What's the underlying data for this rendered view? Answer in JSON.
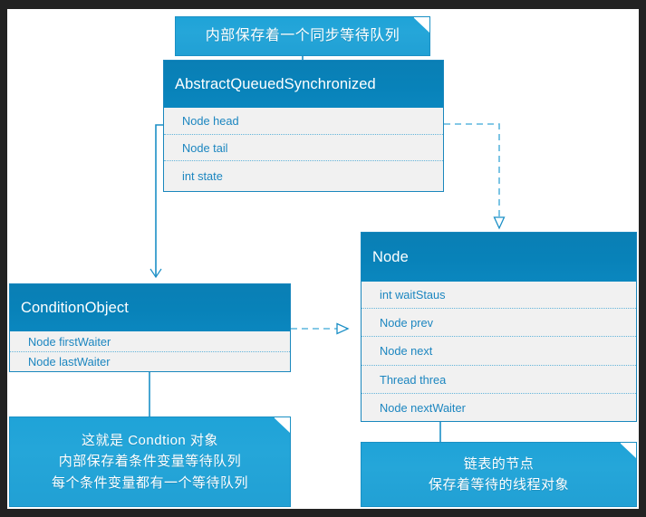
{
  "diagram": {
    "title": "AQS class diagram",
    "colors": {
      "header_blue": "#0882b9",
      "note_blue": "#21a0d4",
      "field_text": "#1c86c0",
      "line_blue": "#1b8fc6",
      "panel_bg": "#f1f1f1",
      "frame": "#222222"
    },
    "classes": [
      {
        "id": "aqs",
        "name": "AbstractQueuedSynchronized",
        "fields": [
          "Node head",
          "Node tail",
          "int state"
        ]
      },
      {
        "id": "condition",
        "name": "ConditionObject",
        "fields": [
          "Node firstWaiter",
          "Node lastWaiter"
        ]
      },
      {
        "id": "node",
        "name": "Node",
        "fields": [
          "int waitStaus",
          "Node prev",
          "Node next",
          "Thread threa",
          "Node nextWaiter"
        ]
      }
    ],
    "notes": [
      {
        "id": "note-top",
        "lines": [
          "内部保存着一个同步等待队列"
        ]
      },
      {
        "id": "note-condition",
        "lines": [
          "这就是 Condtion 对象",
          "内部保存着条件变量等待队列",
          "每个条件变量都有一个等待队列"
        ]
      },
      {
        "id": "note-node",
        "lines": [
          "链表的节点",
          "保存着等待的线程对象"
        ]
      }
    ],
    "connectors": [
      {
        "id": "aqs-to-condition",
        "style": "solid",
        "arrow": "open"
      },
      {
        "id": "aqs-to-node",
        "style": "dashed",
        "arrow": "hollow-triangle"
      },
      {
        "id": "condition-to-node",
        "style": "dashed",
        "arrow": "hollow-triangle"
      },
      {
        "id": "note-top-to-aqs",
        "style": "solid",
        "arrow": "none"
      },
      {
        "id": "condition-to-note",
        "style": "solid",
        "arrow": "none"
      },
      {
        "id": "node-to-note",
        "style": "solid",
        "arrow": "none"
      }
    ]
  }
}
